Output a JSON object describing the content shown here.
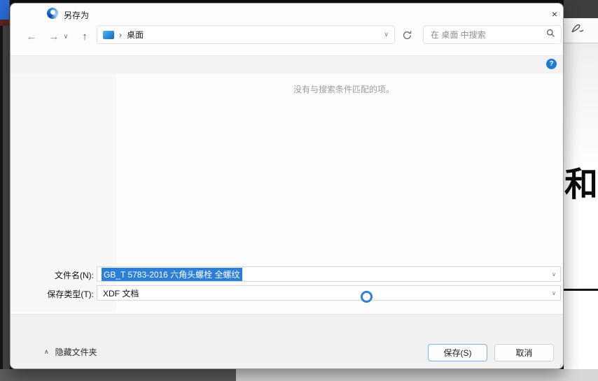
{
  "titlebar": {
    "title": "另存为"
  },
  "icons": {
    "back": "←",
    "forward": "→",
    "history_dropdown": "∨",
    "up": "↑",
    "breadcrumb_separator": "›",
    "address_dropdown": "∨",
    "close": "×",
    "help": "?",
    "field_dropdown": "∨",
    "collapse_caret": "∧"
  },
  "navbar": {
    "breadcrumb_folder": "桌面",
    "search_placeholder": "在 桌面 中搜索"
  },
  "content": {
    "empty_message": "没有与搜索条件匹配的项。"
  },
  "fields": {
    "filename_label": "文件名(N):",
    "filename_value": "GB_T 5783-2016 六角头螺栓 全螺纹",
    "savetype_label": "保存类型(T):",
    "savetype_value": "XDF 文档"
  },
  "footer": {
    "hide_folders_label": "隐藏文件夹",
    "save_label": "保存(S)",
    "cancel_label": "取消"
  },
  "background_app": {
    "heading_char": "和"
  },
  "colors": {
    "selection_blue": "#2b7fd6",
    "help_blue": "#1e7ad3",
    "touch_ring_blue": "#2e7fd6",
    "titlebar_blue_strip": "#2a6bd8"
  }
}
